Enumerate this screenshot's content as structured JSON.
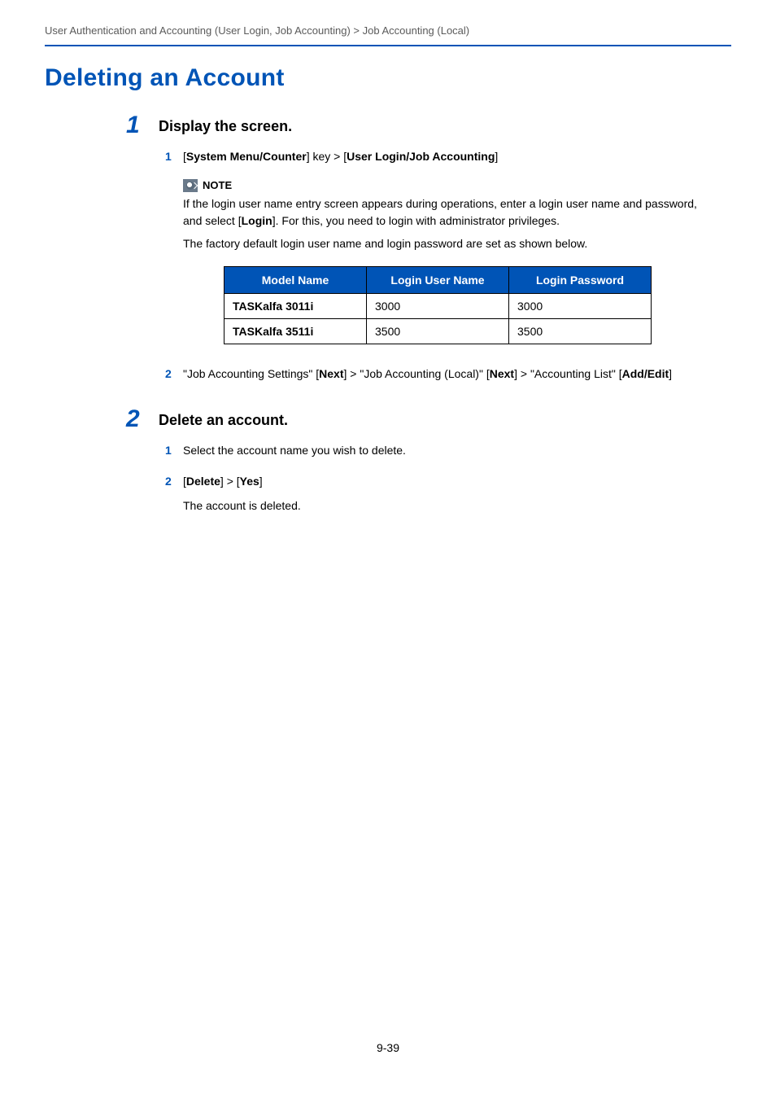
{
  "breadcrumb": "User Authentication and Accounting (User Login, Job Accounting) > Job Accounting (Local)",
  "page_title": "Deleting an Account",
  "step1": {
    "num": "1",
    "heading": "Display the screen.",
    "sub1": {
      "num": "1",
      "p1a": "[",
      "p1b": "System Menu/Counter",
      "p1c": "] key > [",
      "p1d": "User Login/Job Accounting",
      "p1e": "]"
    },
    "note": {
      "label": "NOTE",
      "body1a": "If the login user name entry screen appears during operations, enter a login user name and password, and select [",
      "body1b": "Login",
      "body1c": "]. For this, you need to login with administrator privileges.",
      "body2": "The factory default login user name and login password are set as shown below."
    },
    "table": {
      "head": {
        "c1": "Model Name",
        "c2": "Login User Name",
        "c3": "Login Password"
      },
      "rows": [
        {
          "model": "TASKalfa 3011i",
          "user": "3000",
          "pass": "3000"
        },
        {
          "model": "TASKalfa 3511i",
          "user": "3500",
          "pass": "3500"
        }
      ]
    },
    "sub2": {
      "num": "2",
      "a": "\"Job Accounting Settings\" [",
      "b": "Next",
      "c": "] > \"Job Accounting (Local)\" [",
      "d": "Next",
      "e": "] > \"Accounting List\" [",
      "f": "Add/Edit",
      "g": "]"
    }
  },
  "step2": {
    "num": "2",
    "heading": "Delete an account.",
    "sub1": {
      "num": "1",
      "text": "Select the account name you wish to delete."
    },
    "sub2": {
      "num": "2",
      "a": "[",
      "b": "Delete",
      "c": "] > [",
      "d": "Yes",
      "e": "]"
    },
    "sub2_after": "The account is deleted."
  },
  "page_number": "9-39"
}
